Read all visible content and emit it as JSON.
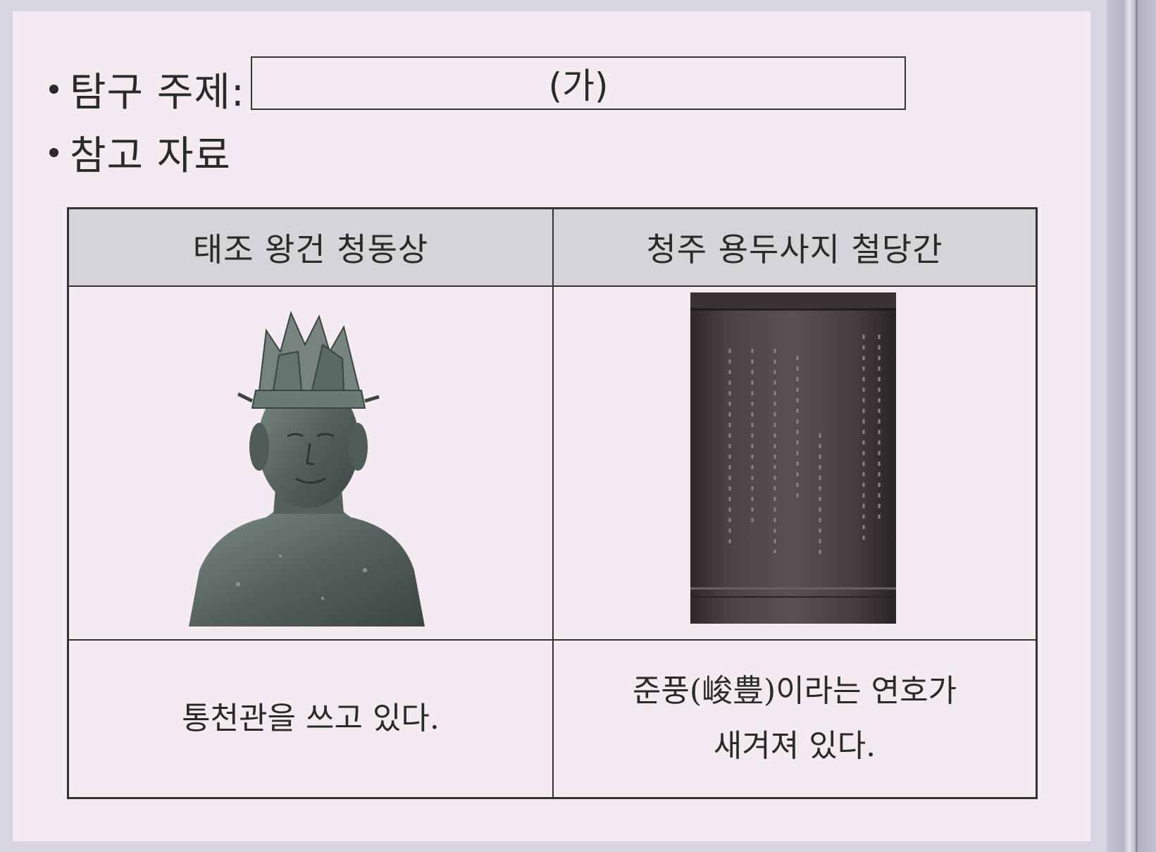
{
  "topic": {
    "label": "탐구 주제:",
    "placeholder": "(가)"
  },
  "reference": {
    "label": "참고 자료"
  },
  "table": {
    "columns": [
      {
        "header": "태조 왕건 청동상",
        "image_icon": "bronze-statue",
        "caption_lines": [
          "통천관을 쓰고 있다."
        ]
      },
      {
        "header": "청주 용두사지 철당간",
        "image_icon": "iron-flagpole",
        "caption_lines": [
          "준풍(峻豊)이라는 연호가",
          "새겨져 있다."
        ]
      }
    ]
  },
  "colors": {
    "page": "#f4eaf2",
    "header": "#d5d4d9",
    "border": "#333333",
    "bronze": "#5a6866",
    "iron": "#4a4043"
  }
}
